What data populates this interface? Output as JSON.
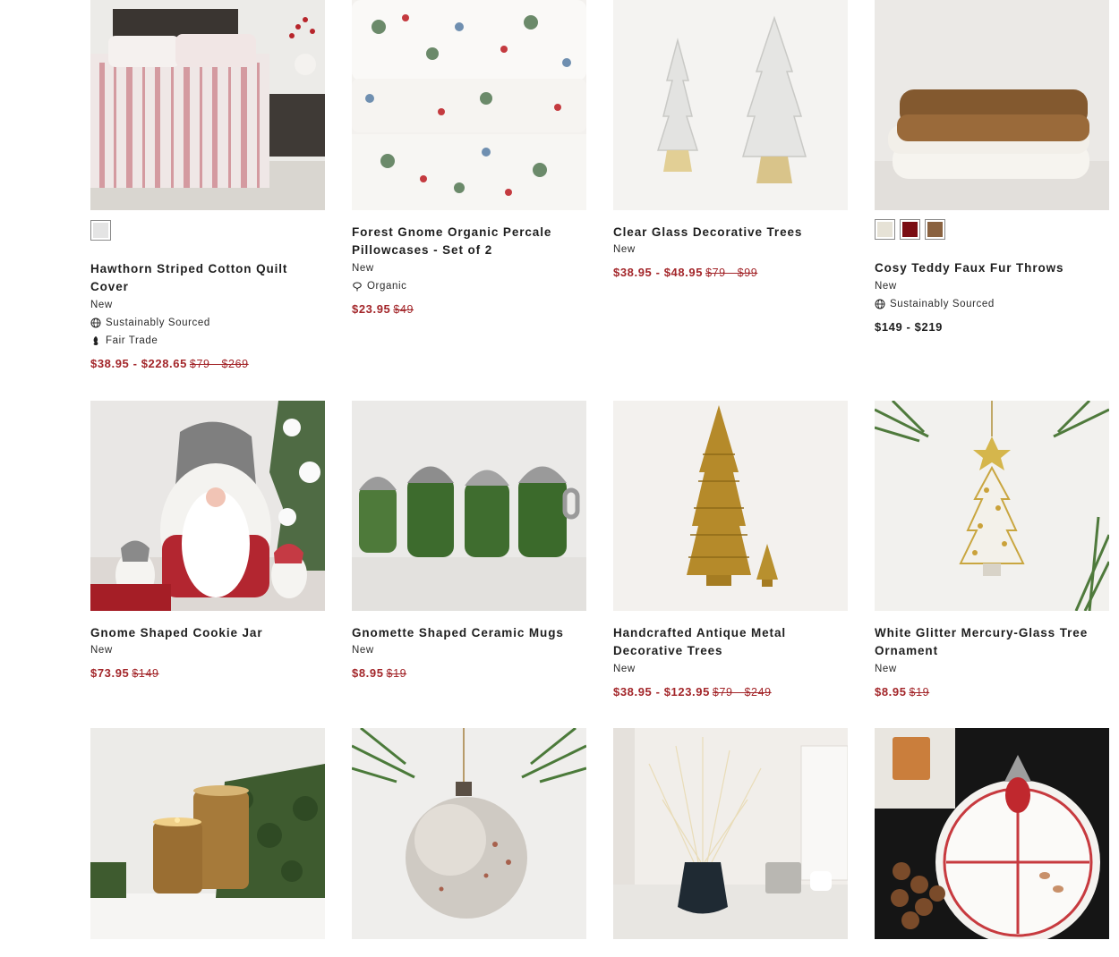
{
  "products": [
    {
      "title": "Hawthorn Striped Cotton Quilt Cover",
      "badge": "New",
      "attr1": "Sustainably Sourced",
      "attr2": "Fair Trade",
      "price_sale": "$38.95 - $228.65",
      "price_reg": "$79 - $269"
    },
    {
      "title": "Forest Gnome Organic Percale Pillowcases - Set of 2",
      "badge": "New",
      "attr1": "Organic",
      "price_sale": "$23.95",
      "price_reg": "$49"
    },
    {
      "title": "Clear Glass Decorative Trees",
      "badge": "New",
      "price_sale": "$38.95 - $48.95",
      "price_reg": "$79 - $99"
    },
    {
      "title": "Cosy Teddy Faux Fur Throws",
      "badge": "New",
      "attr1": "Sustainably Sourced",
      "price_plain": "$149 - $219"
    },
    {
      "title": "Gnome Shaped Cookie Jar",
      "badge": "New",
      "price_sale": "$73.95",
      "price_reg": "$149"
    },
    {
      "title": "Gnomette Shaped Ceramic Mugs",
      "badge": "New",
      "price_sale": "$8.95",
      "price_reg": "$19"
    },
    {
      "title": "Handcrafted Antique Metal Decorative Trees",
      "badge": "New",
      "price_sale": "$38.95 - $123.95",
      "price_reg": "$79 - $249"
    },
    {
      "title": "White Glitter Mercury-Glass Tree Ornament",
      "badge": "New",
      "price_sale": "$8.95",
      "price_reg": "$19"
    }
  ],
  "swatches": {
    "p1": [
      "#e4e4e4"
    ],
    "p4": [
      "#e6e2d6",
      "#7a0c12",
      "#8a6240"
    ]
  },
  "colors": {
    "sale": "#a3262a",
    "text": "#1e1e1e"
  }
}
